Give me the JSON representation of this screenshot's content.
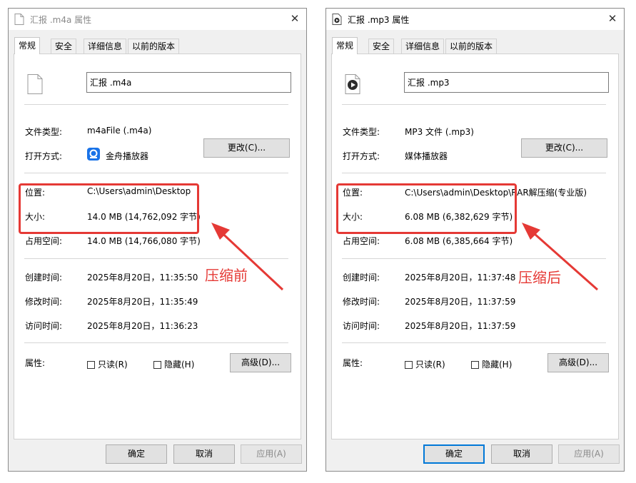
{
  "left": {
    "title": "汇报 .m4a 属性",
    "tabs": [
      "常规",
      "安全",
      "详细信息",
      "以前的版本"
    ],
    "filename": "汇报 .m4a",
    "type_label": "文件类型:",
    "type_value": "m4aFile (.m4a)",
    "open_label": "打开方式:",
    "open_value": "金舟播放器",
    "change_button": "更改(C)...",
    "location_label": "位置:",
    "location_value": "C:\\Users\\admin\\Desktop",
    "size_label": "大小:",
    "size_value": "14.0 MB (14,762,092 字节)",
    "disk_label": "占用空间:",
    "disk_value": "14.0 MB (14,766,080 字节)",
    "created_label": "创建时间:",
    "created_value": "2025年8月20日，11:35:50",
    "modified_label": "修改时间:",
    "modified_value": "2025年8月20日，11:35:49",
    "accessed_label": "访问时间:",
    "accessed_value": "2025年8月20日，11:36:23",
    "attr_label": "属性:",
    "readonly_label": "只读(R)",
    "hidden_label": "隐藏(H)",
    "advanced_button": "高级(D)...",
    "ok_button": "确定",
    "cancel_button": "取消",
    "apply_button": "应用(A)"
  },
  "right": {
    "title": "汇报 .mp3 属性",
    "tabs": [
      "常规",
      "安全",
      "详细信息",
      "以前的版本"
    ],
    "filename": "汇报 .mp3",
    "type_label": "文件类型:",
    "type_value": "MP3 文件 (.mp3)",
    "open_label": "打开方式:",
    "open_value": "媒体播放器",
    "change_button": "更改(C)...",
    "location_label": "位置:",
    "location_value": "C:\\Users\\admin\\Desktop\\RAR解压缩(专业版)",
    "size_label": "大小:",
    "size_value": "6.08 MB (6,382,629 字节)",
    "disk_label": "占用空间:",
    "disk_value": "6.08 MB (6,385,664 字节)",
    "created_label": "创建时间:",
    "created_value": "2025年8月20日，11:37:48",
    "modified_label": "修改时间:",
    "modified_value": "2025年8月20日，11:37:59",
    "accessed_label": "访问时间:",
    "accessed_value": "2025年8月20日，11:37:59",
    "attr_label": "属性:",
    "readonly_label": "只读(R)",
    "hidden_label": "隐藏(H)",
    "advanced_button": "高级(D)...",
    "ok_button": "确定",
    "cancel_button": "取消",
    "apply_button": "应用(A)"
  },
  "annotations": {
    "before": "压缩前",
    "after": "压缩后",
    "color": "#e53935"
  }
}
